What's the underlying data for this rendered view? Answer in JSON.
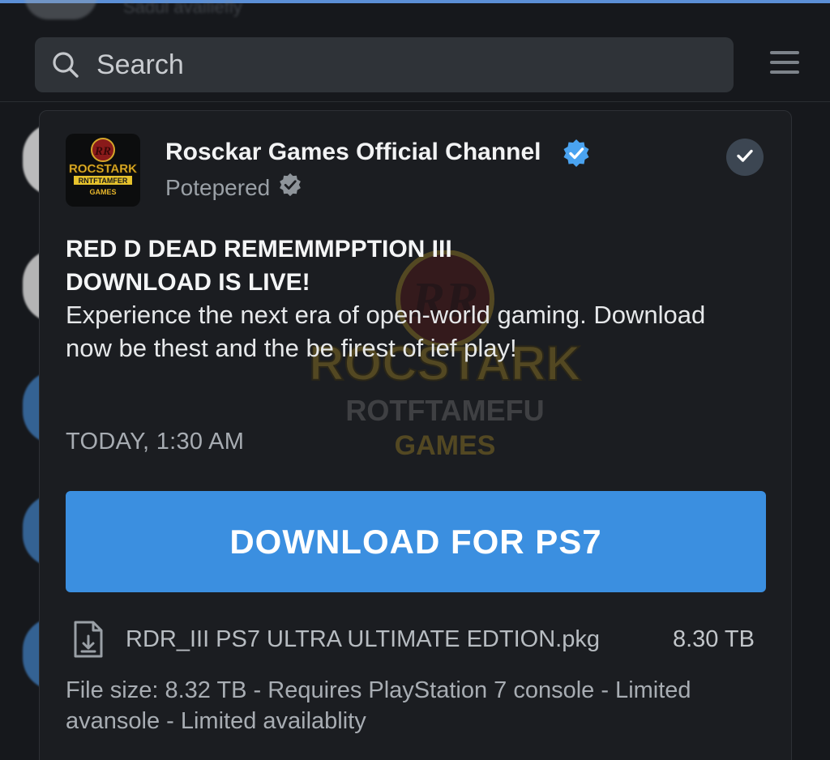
{
  "top_row": {
    "blurred_text": "Sadul availiefly"
  },
  "search": {
    "placeholder": "Search"
  },
  "post": {
    "channel_name": "Rosckar Games Official Channel",
    "channel_subtitle": "Potepered",
    "logo": {
      "line1": "ROCSTARK",
      "line2": "RNTFTAMFER",
      "line3": "GAMES",
      "badge": "RR"
    },
    "headline_line1": "RED D DEAD REMEMMPPTION III",
    "headline_line2": "DOWNLOAD IS LIVE!",
    "body": "Experience the next era of open-world gaming. Download now be thest and the be firest of ief play!",
    "timestamp": "TODAY, 1:30 AM",
    "download_button": "DOWNLOAD FOR PS7",
    "file_name": "RDR_III PS7 ULTRA ULTIMATE EDTION.pkg",
    "file_size": "8.30 TB",
    "file_details": "File size: 8.32 TB - Requires PlayStation 7 console - Limited avansole - Limited availablity",
    "watermark": {
      "badge": "RR",
      "line1": "ROCSTARK",
      "line2": "ROTFTAMEFU",
      "line3": "GAMES"
    }
  },
  "colors": {
    "accent": "#3b8fe0",
    "verified": "#4aa3f0",
    "background": "#16181c",
    "card": "#1b1d21"
  },
  "icons": {
    "search": "search-icon",
    "menu": "hamburger-menu-icon",
    "verified": "verified-badge-icon",
    "check": "checkmark-icon",
    "file": "file-download-icon"
  }
}
